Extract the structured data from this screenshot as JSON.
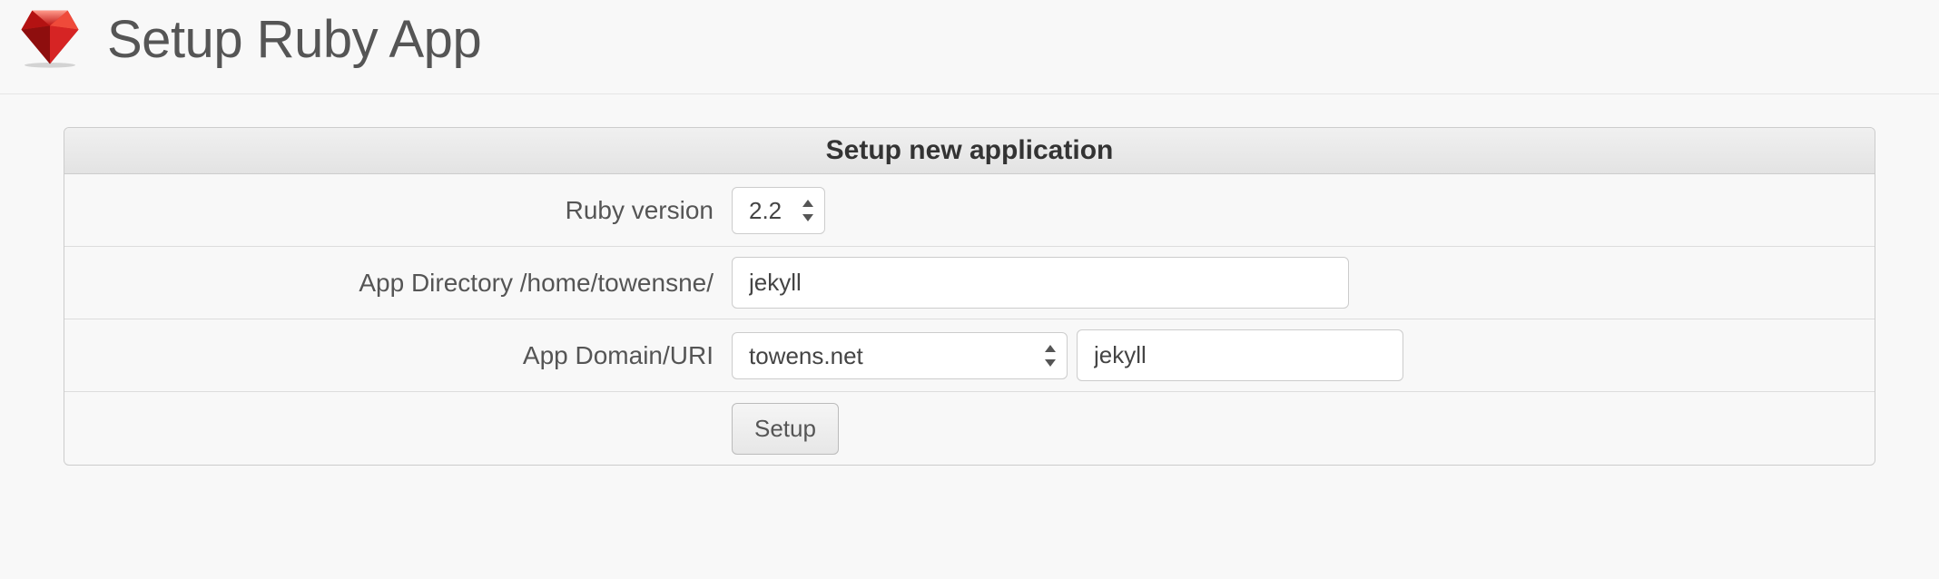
{
  "header": {
    "title": "Setup Ruby App",
    "icon": "ruby-icon"
  },
  "form": {
    "title": "Setup new application",
    "ruby_version": {
      "label": "Ruby version",
      "value": "2.2"
    },
    "app_directory": {
      "label": "App Directory /home/towensne/",
      "value": "jekyll"
    },
    "app_domain_uri": {
      "label": "App Domain/URI",
      "domain_value": "towens.net",
      "uri_value": "jekyll"
    },
    "submit_label": "Setup"
  }
}
